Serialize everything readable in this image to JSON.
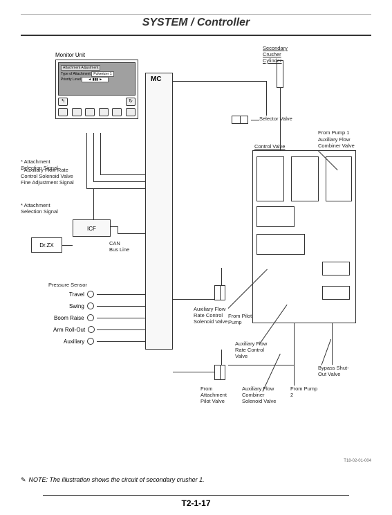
{
  "header": {
    "title": "SYSTEM / Controller"
  },
  "monitor": {
    "label": "Monitor Unit",
    "screen_title": "Attachment Adjustment",
    "screen_row1": "Type of Attachment",
    "screen_tag": "Pulverizer 1",
    "screen_row2": "Priority Level"
  },
  "mc": {
    "label": "MC"
  },
  "icf": {
    "label": "ICF"
  },
  "drzx": {
    "label": "Dr.ZX"
  },
  "labels": {
    "sec_crusher": "Secondary Crusher Cylinder",
    "selector_valve": "Selector Valve",
    "from_pump1": "From Pump 1",
    "aux_flow_combiner": "Auxiliary Flow Combiner Valve",
    "control_valve": "Control Valve",
    "attach_sel_sig1": "* Attachment Selection Signal",
    "aux_flow_fine": "* Auxiliary Flow Rate Control Solenoid Valve Fine Adjustment Signal",
    "attach_sel_sig2": "* Attachment Selection Signal",
    "can_bus": "CAN Bus Line",
    "pressure_sensor": "Pressure Sensor",
    "travel": "Travel",
    "swing": "Swing",
    "boom_raise": "Boom Raise",
    "arm_rollout": "Arm Roll-Out",
    "auxiliary": "Auxiliary",
    "aux_flow_solenoid": "Auxiliary Flow Rate Control Solenoid Valve",
    "from_pilot": "From Pilot Pump",
    "aux_flow_rate_valve": "Auxiliary Flow Rate Control Valve",
    "from_attach_pilot": "From Attachment Pilot Valve",
    "aux_flow_comb_sol": "Auxiliary Flow Combiner Solenoid Valve",
    "bypass_shutout": "Bypass Shut-Out Valve",
    "from_pump2": "From Pump 2"
  },
  "note": "NOTE: The illustration shows the circuit of secondary crusher 1.",
  "fig_id": "T18-02-01-004",
  "page_number": "T2-1-17"
}
